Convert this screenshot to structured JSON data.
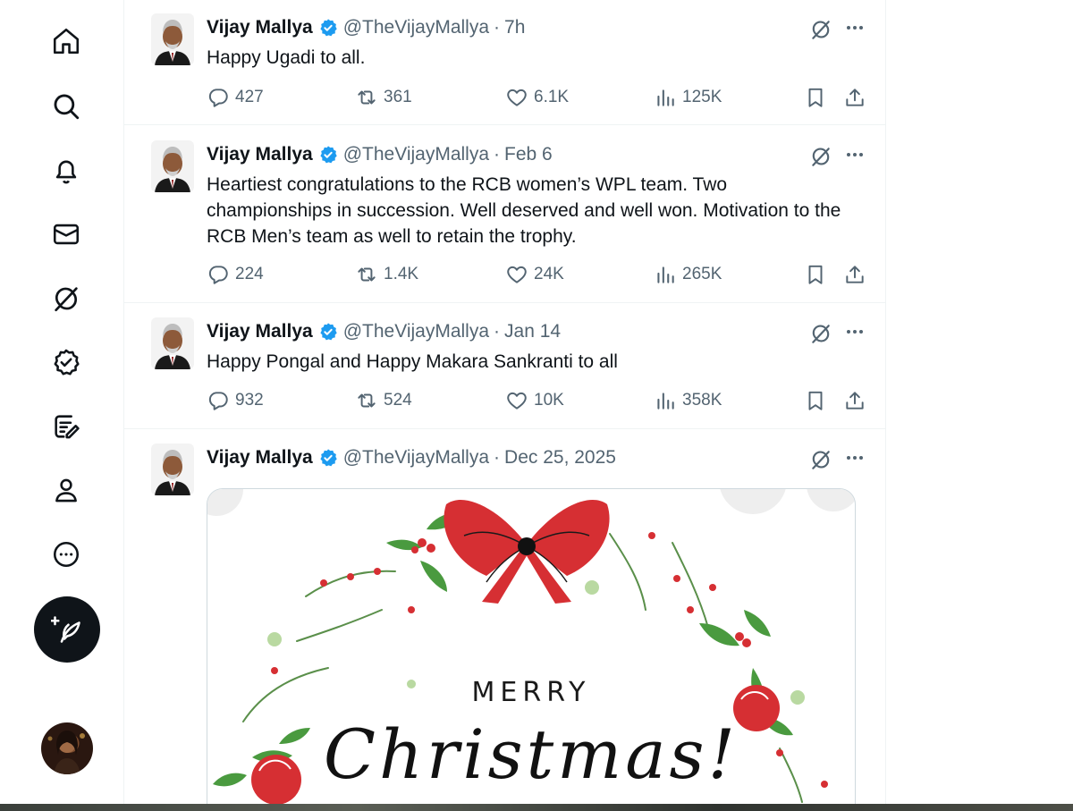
{
  "nav": {
    "items": [
      {
        "name": "home",
        "icon": "home-icon"
      },
      {
        "name": "explore",
        "icon": "search-icon"
      },
      {
        "name": "notifications",
        "icon": "bell-icon"
      },
      {
        "name": "messages",
        "icon": "mail-icon"
      },
      {
        "name": "grok",
        "icon": "grok-icon"
      },
      {
        "name": "verified",
        "icon": "verified-badge-icon"
      },
      {
        "name": "articles",
        "icon": "compose-article-icon"
      },
      {
        "name": "profile",
        "icon": "person-icon"
      },
      {
        "name": "more",
        "icon": "more-circle-icon"
      }
    ],
    "compose_icon": "feather-plus-icon"
  },
  "colors": {
    "verified": "#1d9bf0",
    "text": "#0f1419",
    "muted": "#536471",
    "border": "#eff3f4",
    "wreath_red": "#d62f33",
    "holly_green": "#3f8a3c"
  },
  "tweets": [
    {
      "name": "Vijay Mallya",
      "handle": "@TheVijayMallya",
      "sep": "·",
      "time": "7h",
      "text": "Happy Ugadi to all.",
      "replies": "427",
      "reposts": "361",
      "likes": "6.1K",
      "views": "125K"
    },
    {
      "name": "Vijay Mallya",
      "handle": "@TheVijayMallya",
      "sep": "·",
      "time": "Feb 6",
      "text": "Heartiest congratulations to the RCB women’s WPL team. Two championships in succession. Well deserved and well won. Motivation to the RCB Men’s team as well to retain the trophy.",
      "replies": "224",
      "reposts": "1.4K",
      "likes": "24K",
      "views": "265K"
    },
    {
      "name": "Vijay Mallya",
      "handle": "@TheVijayMallya",
      "sep": "·",
      "time": "Jan 14",
      "text": "Happy Pongal and Happy Makara Sankranti to all",
      "replies": "932",
      "reposts": "524",
      "likes": "10K",
      "views": "358K"
    },
    {
      "name": "Vijay Mallya",
      "handle": "@TheVijayMallya",
      "sep": "·",
      "time": "Dec 25, 2025",
      "media": {
        "line1": "MERRY",
        "line2": "Christmas!"
      }
    }
  ]
}
